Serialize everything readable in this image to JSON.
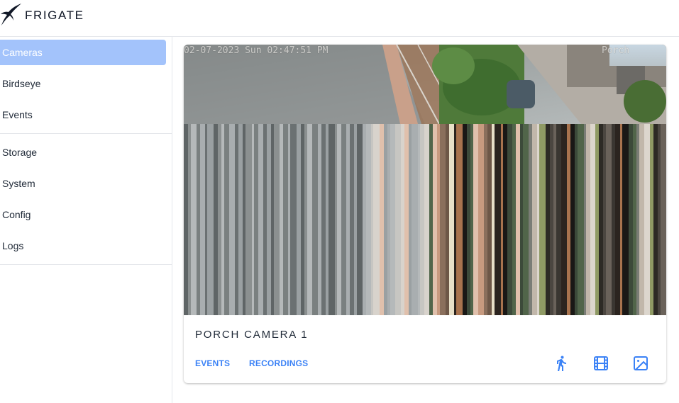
{
  "app": {
    "brand": "FRIGATE",
    "logo_icon": "frigate-bird-icon",
    "accent_color": "#3b82f6",
    "active_nav_color": "#a3c3fb"
  },
  "sidebar": {
    "items": [
      {
        "label": "Cameras",
        "active": true
      },
      {
        "label": "Birdseye",
        "active": false
      },
      {
        "label": "Events",
        "active": false
      },
      {
        "label": "Storage",
        "active": false
      },
      {
        "label": "System",
        "active": false
      },
      {
        "label": "Config",
        "active": false
      },
      {
        "label": "Logs",
        "active": false
      }
    ]
  },
  "camera_card": {
    "title": "PORCH CAMERA 1",
    "feed_timestamp": "02-07-2023 Sun 02:47:51 PM",
    "feed_label": "Porch",
    "actions": {
      "events_label": "EVENTS",
      "recordings_label": "RECORDINGS"
    },
    "icons": [
      "motion-walk-icon",
      "recordings-film-icon",
      "snapshot-image-icon"
    ]
  }
}
